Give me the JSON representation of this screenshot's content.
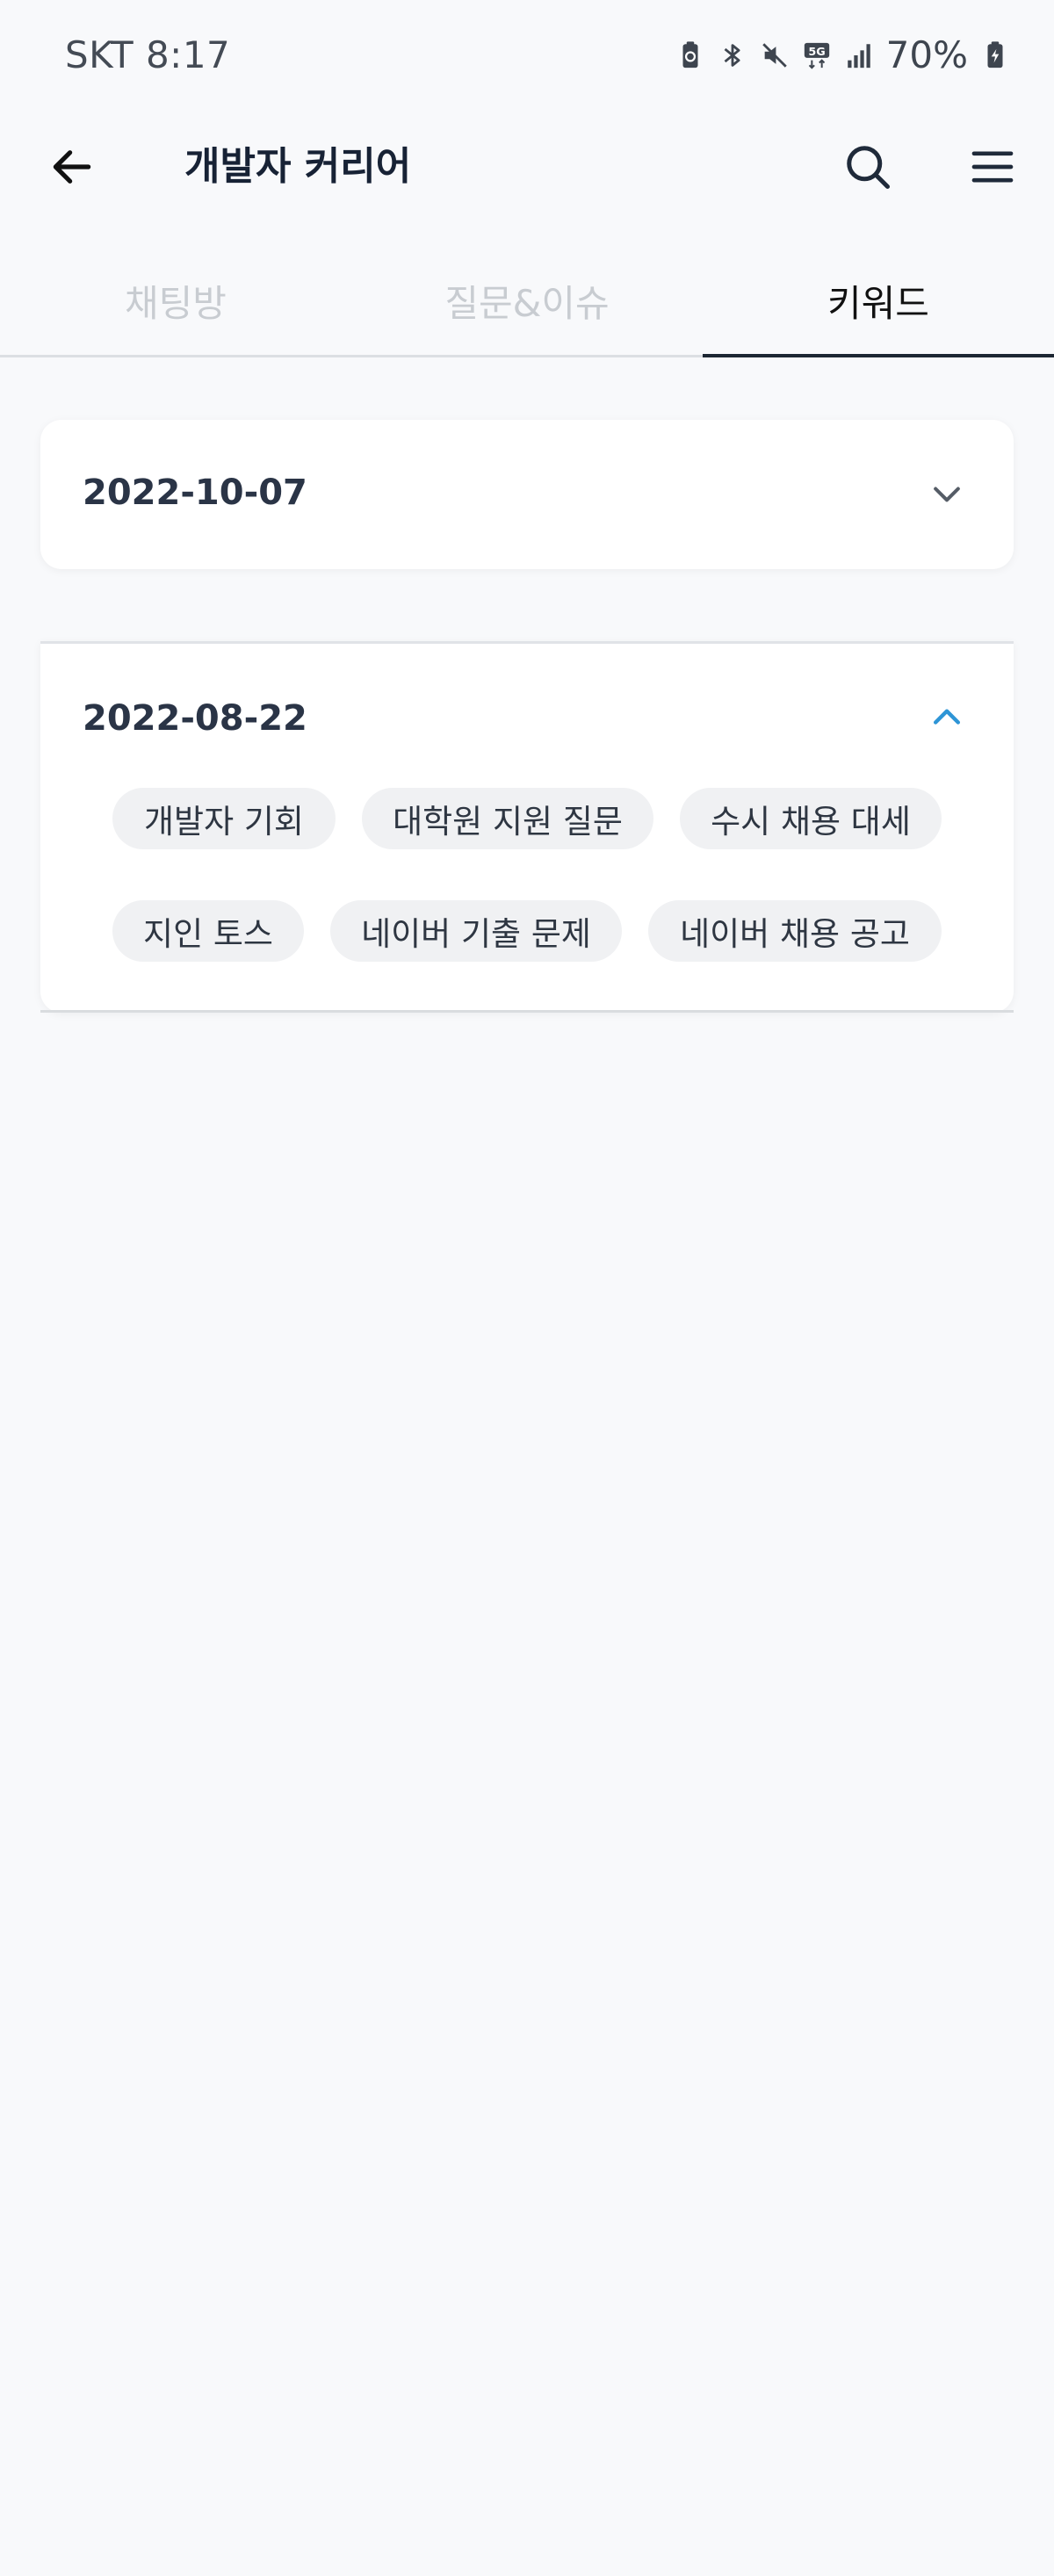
{
  "status_bar": {
    "carrier_time": "SKT 8:17",
    "battery_pct": "70%",
    "network": "5G",
    "icons": [
      "battery-saver-icon",
      "bluetooth-icon",
      "mute-icon",
      "5g-icon",
      "signal-icon",
      "battery-charging-icon"
    ]
  },
  "app_bar": {
    "title": "개발자 커리어",
    "icons": [
      "back-arrow-icon",
      "search-icon",
      "menu-icon"
    ]
  },
  "tabs": [
    {
      "label": "채팅방",
      "active": false
    },
    {
      "label": "질문&이슈",
      "active": false
    },
    {
      "label": "키워드",
      "active": true
    }
  ],
  "sections": [
    {
      "date": "2022-10-07",
      "expanded": false,
      "keywords": []
    },
    {
      "date": "2022-08-22",
      "expanded": true,
      "keywords": [
        "개발자 기회",
        "대학원 지원 질문",
        "수시 채용 대세",
        "지인 토스",
        "네이버 기출 문제",
        "네이버 채용 공고"
      ]
    }
  ],
  "colors": {
    "background": "#f8f9fb",
    "card": "#ffffff",
    "chip": "#f0f1f3",
    "accent_chevron": "#2e95d6",
    "tab_inactive": "#c8ccd1",
    "tab_active": "#111111"
  }
}
